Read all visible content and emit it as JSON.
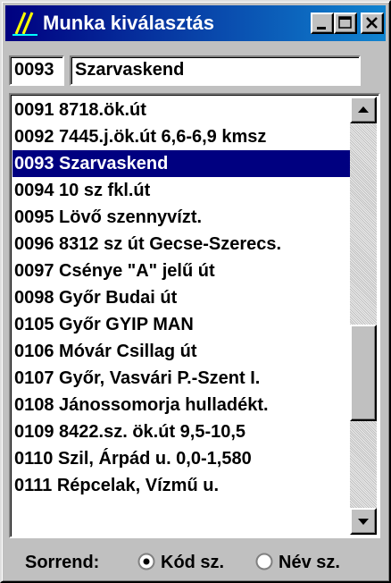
{
  "window": {
    "title": "Munka kiválasztás",
    "icon": "app-logo-icon",
    "buttons": {
      "minimize": "minimize-icon",
      "maximize": "maximize-icon",
      "close": "close-icon"
    }
  },
  "header": {
    "code": "0093",
    "name": "Szarvaskend"
  },
  "list": {
    "items": [
      "0091 8718.ök.út",
      "0092 7445.j.ök.út 6,6-6,9 kmsz",
      "0093 Szarvaskend",
      "0094 10 sz fkl.út",
      "0095 Lövő szennyvízt.",
      "0096 8312 sz út Gecse-Szerecs.",
      "0097 Csénye \"A\" jelű út",
      "0098 Győr Budai út",
      "0105 Győr GYIP MAN",
      "0106 Móvár Csillag út",
      "0107 Győr, Vasvári P.-Szent I.",
      "0108 Jánossomorja hulladékt.",
      "0109 8422.sz. ök.út 9,5-10,5",
      "0110 Szil, Árpád u. 0,0-1,580",
      "0111 Répcelak, Vízmű u."
    ],
    "selected_index": 2,
    "scroll_position": 0.7
  },
  "sort": {
    "label": "Sorrend:",
    "options": [
      {
        "label": "Kód sz.",
        "checked": true
      },
      {
        "label": "Név sz.",
        "checked": false
      }
    ]
  },
  "colors": {
    "title_bar": "#000080",
    "selection": "#000080",
    "face": "#c0c0c0"
  }
}
